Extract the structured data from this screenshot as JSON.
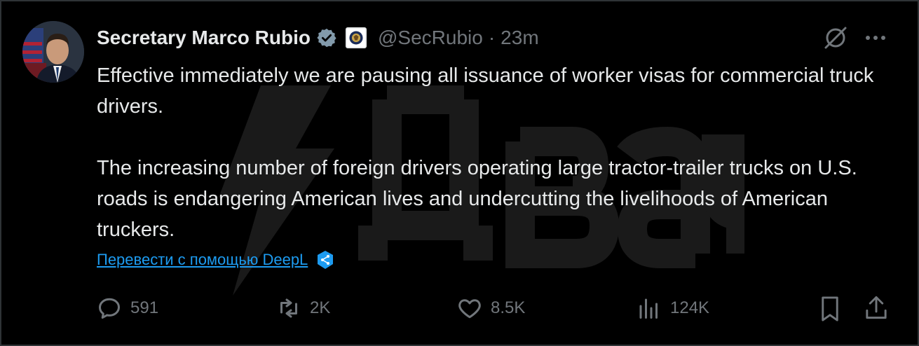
{
  "author": {
    "name": "Secretary Marco Rubio",
    "handle": "@SecRubio",
    "separator": "·",
    "time": "23m"
  },
  "tweet": {
    "paragraphs": [
      "Effective immediately we are pausing all issuance of worker visas for commercial truck drivers.",
      "The increasing number of foreign drivers operating large tractor-trailer trucks on U.S. roads is endangering American lives and undercutting the livelihoods of American truckers."
    ],
    "translate_label": "Перевести с помощью DeepL"
  },
  "actions": {
    "replies": "591",
    "reposts": "2K",
    "likes": "8.5K",
    "views": "124K"
  },
  "icons": [
    "verified-badge-icon",
    "state-department-seal-icon",
    "grok-icon",
    "more-icon",
    "deepl-icon",
    "reply-icon",
    "repost-icon",
    "like-icon",
    "views-icon",
    "bookmark-icon",
    "share-icon"
  ],
  "colors": {
    "background": "#000000",
    "text": "#e7e9ea",
    "muted": "#71767b",
    "link": "#1d9bf0",
    "verified": "#829aab"
  }
}
